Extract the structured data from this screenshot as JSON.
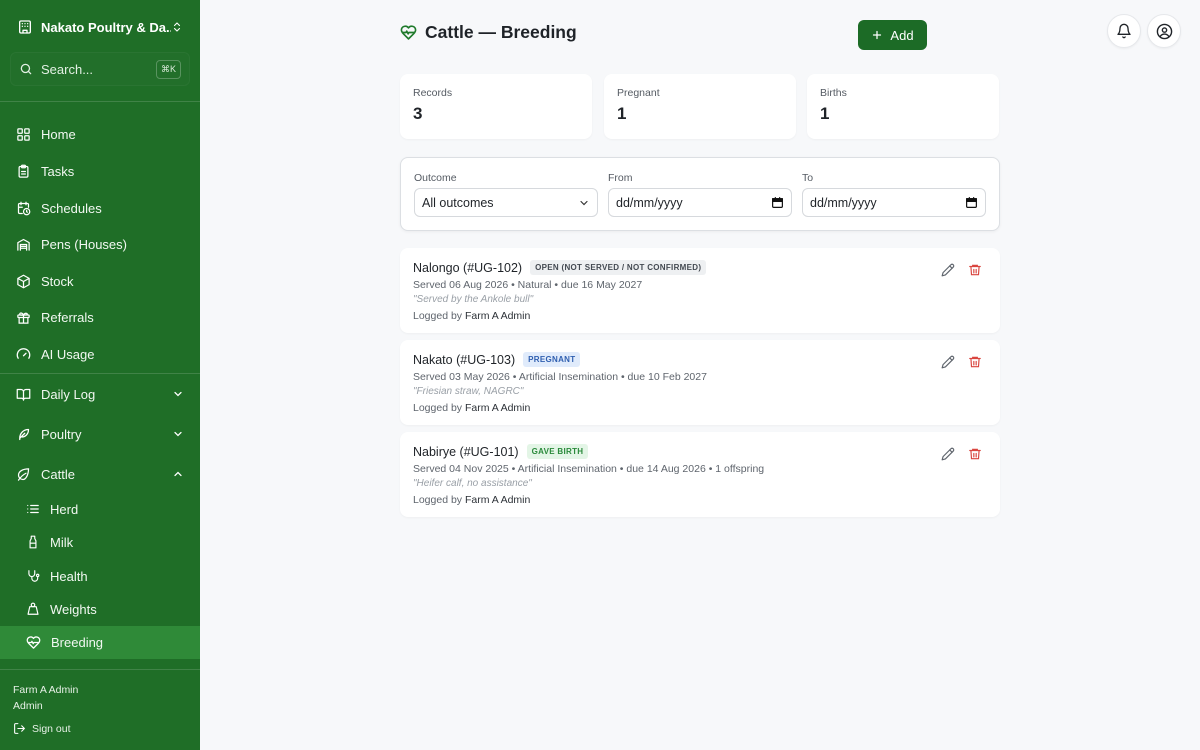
{
  "sidebar": {
    "farm_name": "Nakato Poultry & Da...",
    "search_placeholder": "Search...",
    "search_shortcut": "⌘K",
    "nav": {
      "home": "Home",
      "tasks": "Tasks",
      "schedules": "Schedules",
      "pens": "Pens (Houses)",
      "stock": "Stock",
      "referrals": "Referrals",
      "ai_usage": "AI Usage",
      "daily_log": "Daily Log",
      "poultry": "Poultry",
      "cattle": "Cattle"
    },
    "cattle_sub": {
      "herd": "Herd",
      "milk": "Milk",
      "health": "Health",
      "weights": "Weights",
      "breeding": "Breeding"
    },
    "user": {
      "name": "Farm A Admin",
      "role": "Admin"
    },
    "sign_out": "Sign out"
  },
  "header": {
    "title": "Cattle — Breeding",
    "add_label": "Add"
  },
  "stats": [
    {
      "label": "Records",
      "value": "3"
    },
    {
      "label": "Pregnant",
      "value": "1"
    },
    {
      "label": "Births",
      "value": "1"
    }
  ],
  "filters": {
    "outcome_label": "Outcome",
    "outcome_value": "All outcomes",
    "from_label": "From",
    "from_value": "dd/mm/yyyy",
    "to_label": "To",
    "to_value": "dd/mm/yyyy"
  },
  "records": [
    {
      "name": "Nalongo (#UG-102)",
      "badge": "OPEN (NOT SERVED / NOT CONFIRMED)",
      "details": "Served 06 Aug 2026 • Natural • due 16 May 2027",
      "note": "\"Served by the Ankole bull\"",
      "logged_prefix": "Logged by",
      "logged_by": "Farm A Admin"
    },
    {
      "name": "Nakato (#UG-103)",
      "badge": "PREGNANT",
      "details": "Served 03 May 2026 • Artificial Insemination • due 10 Feb 2027",
      "note": "\"Friesian straw, NAGRC\"",
      "logged_prefix": "Logged by",
      "logged_by": "Farm A Admin"
    },
    {
      "name": "Nabirye (#UG-101)",
      "badge": "GAVE BIRTH",
      "details": "Served 04 Nov 2025 • Artificial Insemination • due 14 Aug 2026 • 1 offspring",
      "note": "\"Heifer calf, no assistance\"",
      "logged_prefix": "Logged by",
      "logged_by": "Farm A Admin"
    }
  ],
  "colors": {
    "sidebar_bg": "#1f6e27",
    "active_bg": "#2f8a38",
    "primary_button": "#1c6b26",
    "delete_icon": "#d9453f"
  }
}
